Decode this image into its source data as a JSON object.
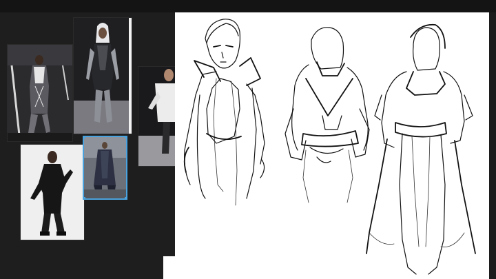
{
  "app": {
    "background": "#1c1c1c",
    "canvas_color": "#ffffff",
    "selection_color": "#4aa3df"
  },
  "reference_board": {
    "images": [
      {
        "id": "runway-white-harness",
        "icon": "photo-icon"
      },
      {
        "id": "runway-silver-hair",
        "icon": "photo-icon"
      },
      {
        "id": "runway-white-top",
        "icon": "photo-icon"
      },
      {
        "id": "studio-black-jumpsuit",
        "icon": "photo-icon"
      },
      {
        "id": "runway-dark-coat",
        "icon": "photo-icon",
        "selected": true
      }
    ]
  },
  "sketch_canvas": {
    "figures": [
      "figure-left-collar-jacket",
      "figure-middle-hood-tunic",
      "figure-right-long-cloak"
    ]
  }
}
